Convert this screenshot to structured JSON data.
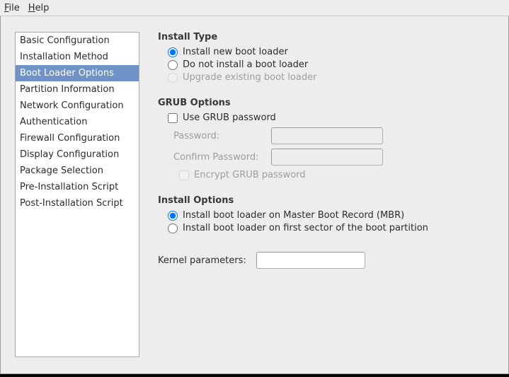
{
  "menubar": {
    "file": "File",
    "help": "Help"
  },
  "sidebar": {
    "items": [
      {
        "label": "Basic Configuration"
      },
      {
        "label": "Installation Method"
      },
      {
        "label": "Boot Loader Options"
      },
      {
        "label": "Partition Information"
      },
      {
        "label": "Network Configuration"
      },
      {
        "label": "Authentication"
      },
      {
        "label": "Firewall Configuration"
      },
      {
        "label": "Display Configuration"
      },
      {
        "label": "Package Selection"
      },
      {
        "label": "Pre-Installation Script"
      },
      {
        "label": "Post-Installation Script"
      }
    ],
    "selected_index": 2
  },
  "install_type": {
    "title": "Install Type",
    "opt_install_new": "Install new boot loader",
    "opt_do_not_install": "Do not install a boot loader",
    "opt_upgrade": "Upgrade existing boot loader",
    "selected": "install_new",
    "upgrade_enabled": false
  },
  "grub": {
    "title": "GRUB Options",
    "use_pw_label": "Use GRUB password",
    "use_pw_checked": false,
    "password_label": "Password:",
    "password_value": "",
    "confirm_label": "Confirm Password:",
    "confirm_value": "",
    "encrypt_label": "Encrypt GRUB password",
    "encrypt_checked": false
  },
  "install_options": {
    "title": "Install Options",
    "opt_mbr": "Install boot loader on Master Boot Record (MBR)",
    "opt_first_sector": "Install boot loader on first sector of the boot partition",
    "selected": "mbr"
  },
  "kernel_params": {
    "label": "Kernel parameters:",
    "value": ""
  }
}
